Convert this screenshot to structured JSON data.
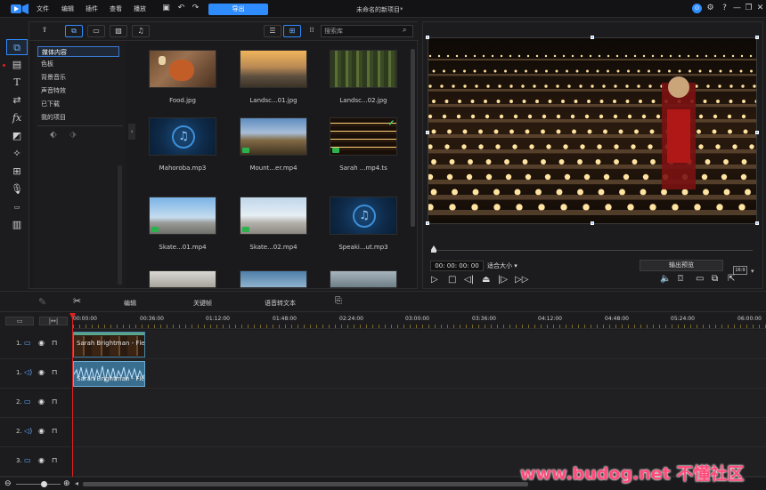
{
  "menu": [
    "文件",
    "编辑",
    "插件",
    "查看",
    "播放"
  ],
  "toolbar": {
    "export_label": "导出"
  },
  "project_title": "未命名的新项目*",
  "window_controls": [
    "?",
    "—",
    "❐",
    "✕"
  ],
  "library": {
    "search_placeholder": "搜索库",
    "categories": [
      "媒体内容",
      "色板",
      "背景音乐",
      "声音特效",
      "已下载",
      "我的项目"
    ],
    "media": [
      {
        "label": "Food.jpg"
      },
      {
        "label": "Landsc...01.jpg"
      },
      {
        "label": "Landsc...02.jpg"
      },
      {
        "label": "Mahoroba.mp3"
      },
      {
        "label": "Mount...er.mp4"
      },
      {
        "label": "Sarah ...mp4.ts"
      },
      {
        "label": "Skate...01.mp4"
      },
      {
        "label": "Skate...02.mp4"
      },
      {
        "label": "Speaki...ut.mp3"
      }
    ]
  },
  "preview": {
    "timecode": "00: 00: 00: 00",
    "fit_label": "适合大小",
    "output_label": "输出预览",
    "aspect": "16:9"
  },
  "editbar": {
    "edit": "编辑",
    "keyframe": "关键帧",
    "speech_text": "语音转文本"
  },
  "timeline": {
    "ticks": [
      "00:00:00",
      "00:36:00",
      "01:12:00",
      "01:48:00",
      "02:24:00",
      "03:00:00",
      "03:36:00",
      "04:12:00",
      "04:48:00",
      "05:24:00",
      "06:00:00"
    ],
    "tracks": [
      {
        "label": "1.",
        "type": "video"
      },
      {
        "label": "1.",
        "type": "audio"
      },
      {
        "label": "2.",
        "type": "video"
      },
      {
        "label": "2.",
        "type": "audio"
      },
      {
        "label": "3.",
        "type": "video"
      }
    ],
    "clip_video_label": "Sarah Brightman - Fle",
    "clip_audio_label": "Sarah Brightman - Fle"
  },
  "watermark": "www.budog.net 不懂社区",
  "colors": {
    "accent": "#2f8cff",
    "playhead": "#e02020",
    "clip": "#3a6e8f"
  }
}
